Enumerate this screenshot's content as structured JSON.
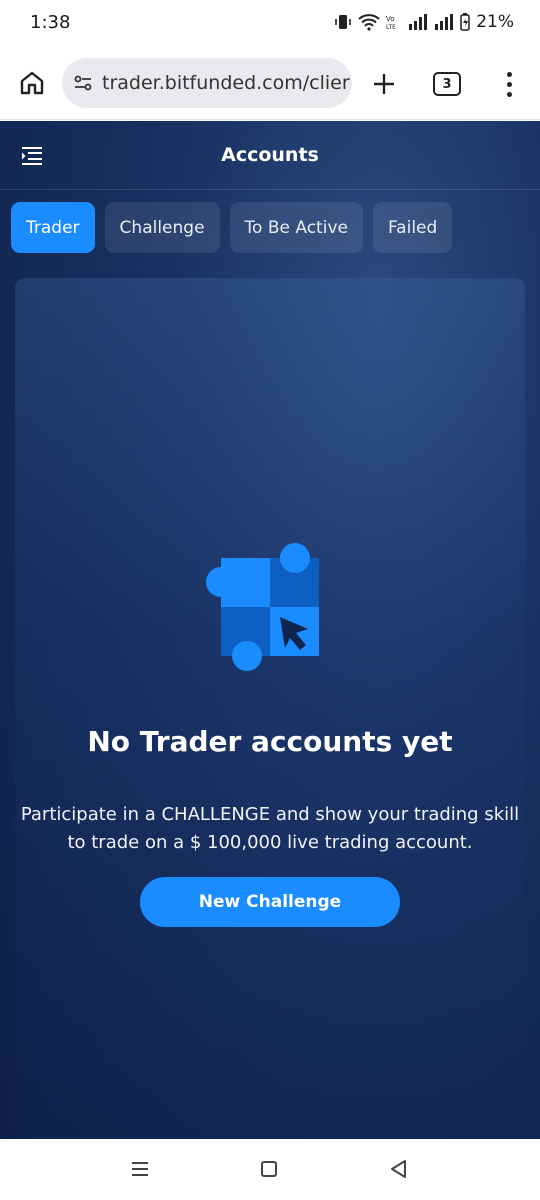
{
  "status_bar": {
    "time": "1:38",
    "battery": "21%",
    "icons": [
      "vibrate-icon",
      "wifi-icon",
      "volte-icon",
      "signal-icon",
      "signal-icon",
      "battery-icon"
    ]
  },
  "browser": {
    "url": "trader.bitfunded.com/clier",
    "tab_count": "3"
  },
  "header": {
    "title": "Accounts"
  },
  "tabs": [
    {
      "label": "Trader",
      "active": true
    },
    {
      "label": "Challenge",
      "active": false
    },
    {
      "label": "To Be Active",
      "active": false
    },
    {
      "label": "Failed",
      "active": false
    }
  ],
  "empty_state": {
    "title": "No Trader accounts yet",
    "description": "Participate in a CHALLENGE and show your trading skill to trade on a $ 100,000 live trading account.",
    "button_label": "New Challenge"
  },
  "colors": {
    "accent": "#1a8cff",
    "background": "#142b58"
  }
}
